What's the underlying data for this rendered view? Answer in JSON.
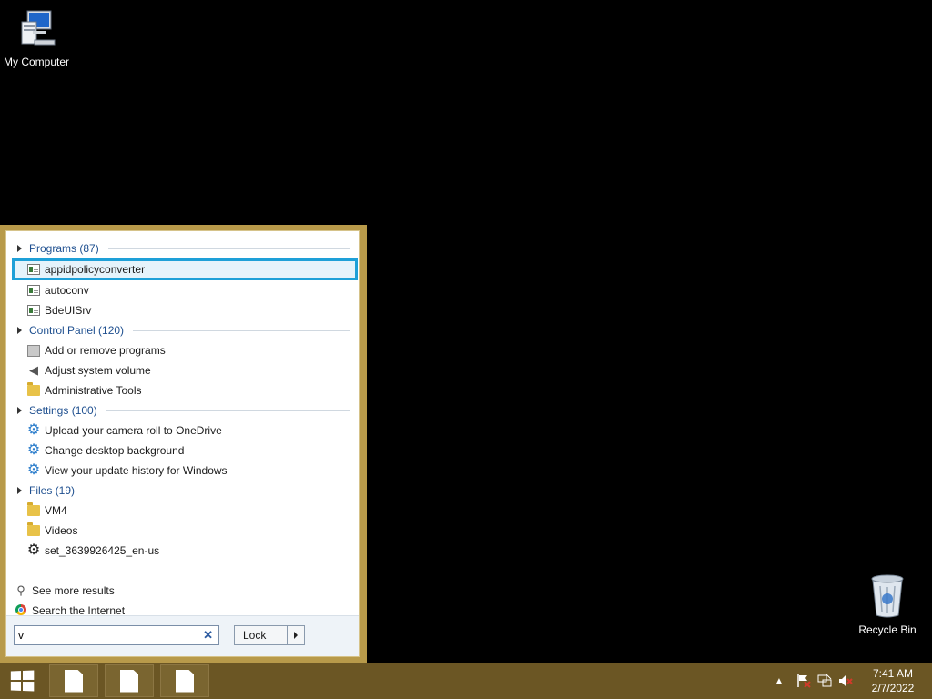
{
  "desktop": {
    "my_computer": "My Computer",
    "recycle_bin": "Recycle Bin"
  },
  "start_menu": {
    "groups": [
      {
        "title": "Programs (87)",
        "items": [
          {
            "label": "appidpolicyconverter",
            "icon": "exe-icon"
          },
          {
            "label": "autoconv",
            "icon": "exe-icon"
          },
          {
            "label": "BdeUISrv",
            "icon": "exe-icon"
          }
        ]
      },
      {
        "title": "Control Panel (120)",
        "items": [
          {
            "label": "Add or remove programs",
            "icon": "programs-icon"
          },
          {
            "label": "Adjust system volume",
            "icon": "speaker-icon"
          },
          {
            "label": "Administrative Tools",
            "icon": "folder-icon"
          }
        ]
      },
      {
        "title": "Settings (100)",
        "items": [
          {
            "label": "Upload your camera roll to OneDrive",
            "icon": "gear-icon"
          },
          {
            "label": "Change desktop background",
            "icon": "gear-icon"
          },
          {
            "label": "View your update history for Windows",
            "icon": "gear-icon"
          }
        ]
      },
      {
        "title": "Files (19)",
        "items": [
          {
            "label": "VM4",
            "icon": "folder-icon"
          },
          {
            "label": "Videos",
            "icon": "folder-icon"
          },
          {
            "label": "set_3639926425_en-us",
            "icon": "gear-icon"
          }
        ]
      }
    ],
    "see_more": "See more results",
    "search_internet": "Search the Internet",
    "search_value": "v",
    "lock_label": "Lock"
  },
  "taskbar": {
    "time": "7:41 AM",
    "date": "2/7/2022"
  },
  "colors": {
    "taskbar": "#6b5624",
    "menu_frame": "#b89a4a",
    "highlight": "#1ea0d8",
    "group_text": "#1e4f8f"
  }
}
